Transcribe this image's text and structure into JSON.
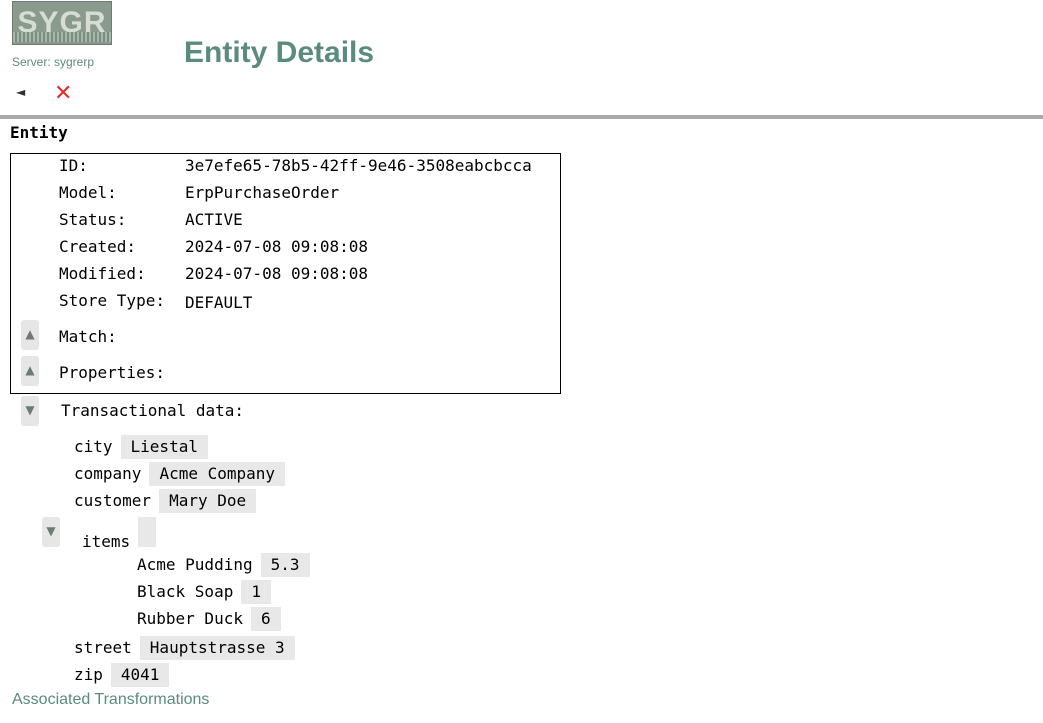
{
  "header": {
    "logo_text": "SYGR",
    "server_label": "Server: sygrerp",
    "page_title": "Entity Details",
    "back_icon": "triangle-left-icon",
    "close_icon": "red-x-icon",
    "back_glyph": "◄",
    "close_glyph": "✕"
  },
  "entity": {
    "section_title": "Entity",
    "fields": [
      {
        "label": "ID:",
        "value": "3e7efe65-78b5-42ff-9e46-3508eabcbcca"
      },
      {
        "label": "Model:",
        "value": "ErpPurchaseOrder"
      },
      {
        "label": "Status:",
        "value": "ACTIVE"
      },
      {
        "label": "Created:",
        "value": "2024-07-08 09:08:08"
      },
      {
        "label": "Modified:",
        "value": "2024-07-08 09:08:08"
      },
      {
        "label": "Store Type:",
        "value": "DEFAULT"
      }
    ],
    "match_label": "Match:",
    "properties_label": "Properties:",
    "collapsed_glyph": "▲",
    "expanded_glyph": "▼"
  },
  "transactional": {
    "label": "Transactional data:",
    "city": {
      "key": "city",
      "value": "Liestal"
    },
    "company": {
      "key": "company",
      "value": "Acme Company"
    },
    "customer": {
      "key": "customer",
      "value": "Mary Doe"
    },
    "items": {
      "key": "items",
      "value": "",
      "list": [
        {
          "key": "Acme Pudding",
          "value": "5.3"
        },
        {
          "key": "Black Soap",
          "value": "1"
        },
        {
          "key": "Rubber Duck",
          "value": "6"
        }
      ]
    },
    "street": {
      "key": "street",
      "value": "Hauptstrasse 3"
    },
    "zip": {
      "key": "zip",
      "value": "4041"
    }
  },
  "footer": {
    "associated_link": "Associated Transformations"
  },
  "colors": {
    "accent": "#5b8b7e",
    "close_red": "#e03030",
    "chip_bg": "#e8e8e8"
  }
}
